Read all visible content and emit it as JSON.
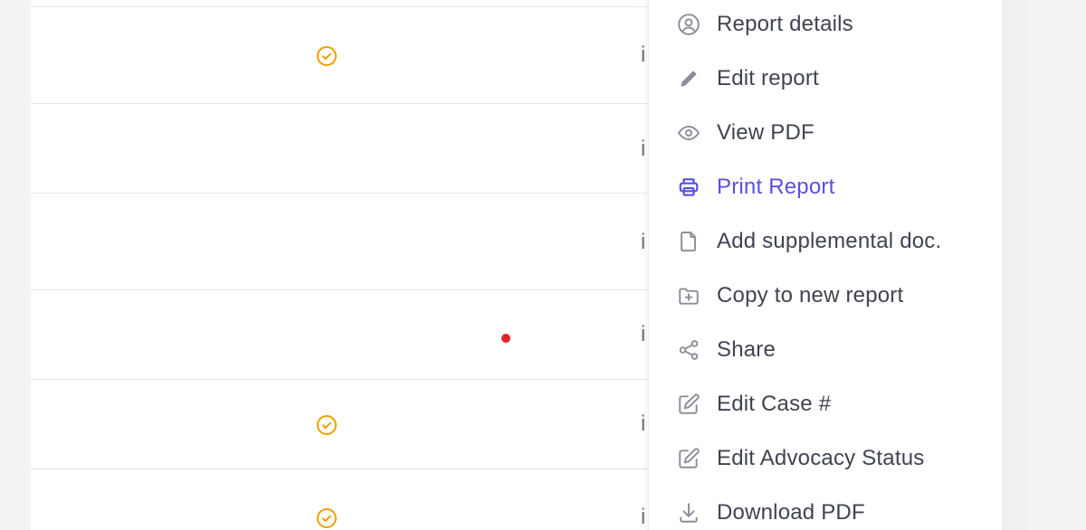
{
  "colors": {
    "status_check": "#f0a000",
    "red_dot": "#e0242c",
    "menu_text": "#3f4450",
    "menu_icon": "#8a8f99",
    "active": "#5b4fe0"
  },
  "table": {
    "rows": [
      {
        "status_icon": "check-circle-icon",
        "indicator": "",
        "kebab": "i"
      },
      {
        "status_icon": "",
        "indicator": "",
        "kebab": "i"
      },
      {
        "status_icon": "",
        "indicator": "",
        "kebab": "i"
      },
      {
        "status_icon": "",
        "indicator": "red-dot",
        "kebab": "i"
      },
      {
        "status_icon": "check-circle-icon",
        "indicator": "",
        "kebab": "i"
      },
      {
        "status_icon": "check-circle-icon",
        "indicator": "",
        "kebab": "i"
      }
    ]
  },
  "context_menu": {
    "items": [
      {
        "label": "Report details",
        "icon": "user-circle-icon"
      },
      {
        "label": "Edit report",
        "icon": "pencil-icon"
      },
      {
        "label": "View PDF",
        "icon": "eye-icon"
      },
      {
        "label": "Print Report",
        "icon": "printer-icon",
        "active": true
      },
      {
        "label": "Add supplemental doc.",
        "icon": "document-icon"
      },
      {
        "label": "Copy to new report",
        "icon": "folder-plus-icon"
      },
      {
        "label": "Share",
        "icon": "share-icon"
      },
      {
        "label": "Edit Case #",
        "icon": "edit-square-icon"
      },
      {
        "label": "Edit Advocacy Status",
        "icon": "edit-square-icon"
      },
      {
        "label": "Download PDF",
        "icon": "download-icon"
      }
    ]
  }
}
